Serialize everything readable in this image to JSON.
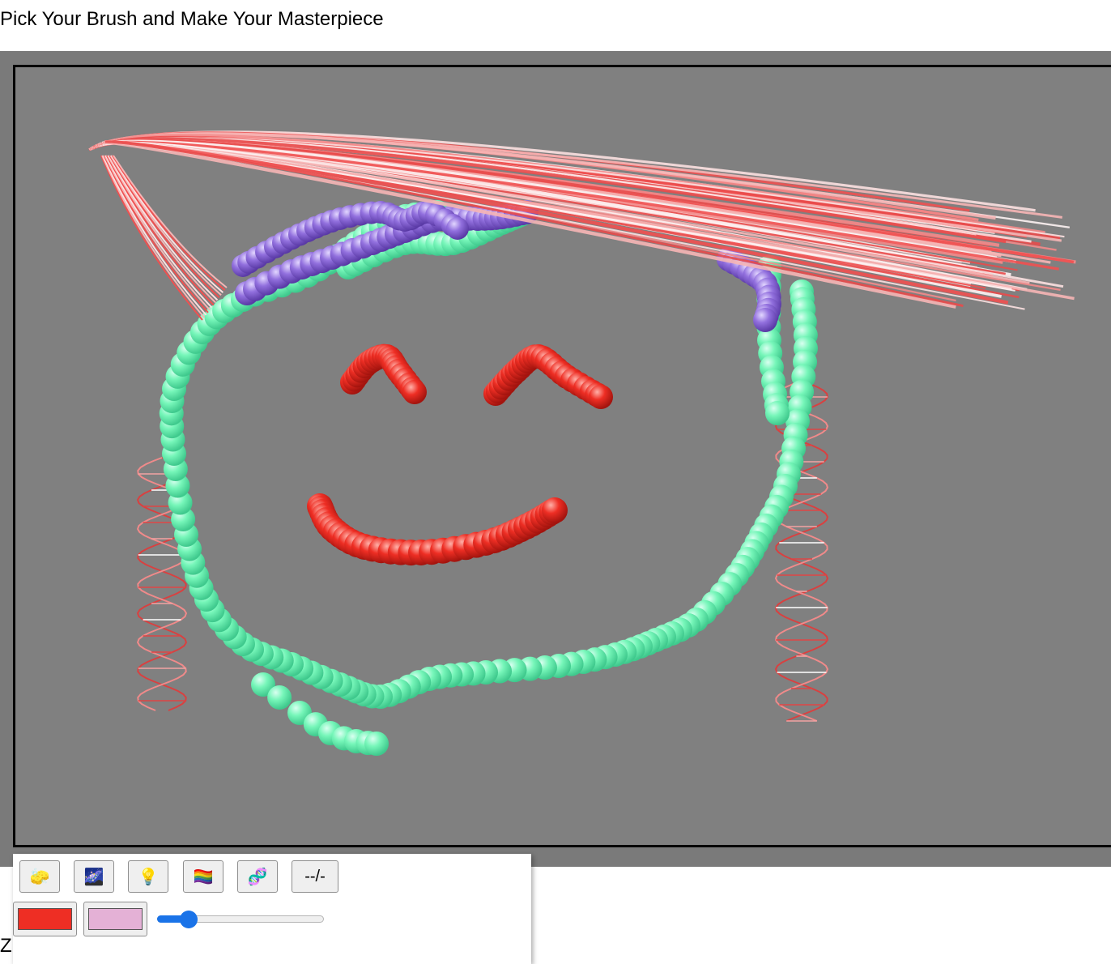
{
  "page": {
    "title": "Pick Your Brush and Make Your Masterpiece",
    "footer_text": "Z"
  },
  "canvas": {
    "background_color": "#808080",
    "drawing_description": "smiley face painted with sphere, line and helix brushes"
  },
  "toolbar": {
    "tools": [
      {
        "name": "eraser-sponge",
        "icon": "sponge-icon",
        "glyph": "🧽"
      },
      {
        "name": "galaxy-brush",
        "icon": "galaxy-icon",
        "glyph": "🌌"
      },
      {
        "name": "light-brush",
        "icon": "lightbulb-icon",
        "glyph": "💡"
      },
      {
        "name": "rainbow-brush",
        "icon": "rainbow-flag-icon",
        "glyph": "🏳️‍🌈"
      },
      {
        "name": "dna-brush",
        "icon": "dna-icon",
        "glyph": "🧬"
      },
      {
        "name": "line-brush",
        "label": "--/-"
      }
    ],
    "primary_color": "#ee2e24",
    "secondary_color": "#e4b1d6",
    "brush_size": 0.15
  },
  "colors": {
    "sphere_green": "#6ff5b4",
    "sphere_purple": "#8a63d8",
    "sphere_red": "#ee2e24",
    "stroke_red": "#f05050",
    "stroke_pink": "#f6b5b5",
    "stroke_white": "#fdf2f2"
  }
}
